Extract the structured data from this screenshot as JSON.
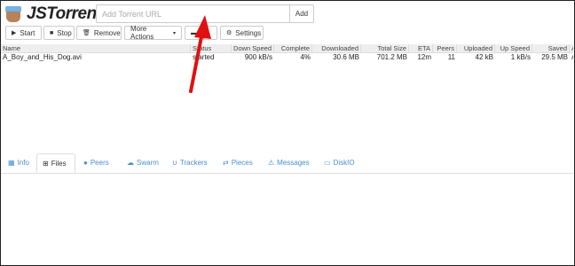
{
  "header": {
    "logo_text": "JSTorrent",
    "url_placeholder": "Add Torrent URL",
    "add_label": "Add"
  },
  "toolbar": {
    "start_label": "Start",
    "stop_label": "Stop",
    "remove_label": "Remove",
    "more_actions_label": "More Actions",
    "hidden_label": "…n",
    "settings_label": "Settings"
  },
  "table": {
    "columns": [
      "Name",
      "Status",
      "Down Speed",
      "Complete",
      "Downloaded",
      "Total Size",
      "ETA",
      "Peers",
      "Uploaded",
      "Up Speed",
      "Saved",
      "A"
    ],
    "rows": [
      {
        "name": "A_Boy_and_His_Dog.avi",
        "status": "started",
        "down_speed": "900 kB/s",
        "complete": "4%",
        "downloaded": "30.6 MB",
        "total_size": "701.2 MB",
        "eta": "12m",
        "peers": "11",
        "uploaded": "42 kB",
        "up_speed": "1 kB/s",
        "saved": "29.5 MB",
        "extra": "A"
      }
    ]
  },
  "tabs": [
    {
      "label": "Info",
      "icon": "grid-icon"
    },
    {
      "label": "Files",
      "icon": "sitemap-icon"
    },
    {
      "label": "Peers",
      "icon": "user-icon"
    },
    {
      "label": "Swarm",
      "icon": "cloud-icon"
    },
    {
      "label": "Trackers",
      "icon": "magnet-icon"
    },
    {
      "label": "Pieces",
      "icon": "swap-icon"
    },
    {
      "label": "Messages",
      "icon": "warning-icon"
    },
    {
      "label": "DiskIO",
      "icon": "disk-icon"
    }
  ],
  "colors": {
    "accent": "#4a8ed3",
    "annotation": "#e01010"
  }
}
